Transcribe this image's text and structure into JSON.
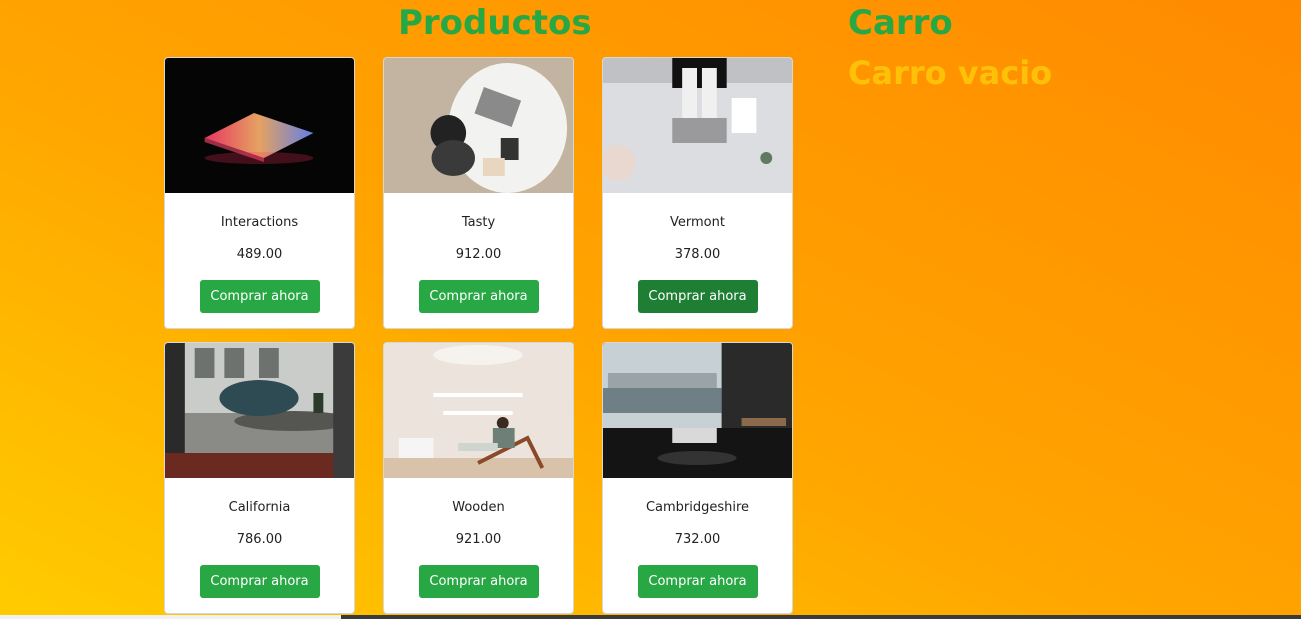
{
  "headings": {
    "products": "Productos",
    "cart": "Carro",
    "cart_empty": "Carro vacio"
  },
  "products": [
    {
      "name": "Interactions",
      "price": "489.00",
      "button": "Comprar ahora",
      "image": "laptop-dark-image"
    },
    {
      "name": "Tasty",
      "price": "912.00",
      "button": "Comprar ahora",
      "image": "desk-overhead-image"
    },
    {
      "name": "Vermont",
      "price": "378.00",
      "button": "Comprar ahora",
      "image": "typing-desk-image"
    },
    {
      "name": "California",
      "price": "786.00",
      "button": "Comprar ahora",
      "image": "living-room-laptop-image"
    },
    {
      "name": "Wooden",
      "price": "921.00",
      "button": "Comprar ahora",
      "image": "lounge-chair-image"
    },
    {
      "name": "Cambridgeshire",
      "price": "732.00",
      "button": "Comprar ahora",
      "image": "city-window-office-image"
    }
  ],
  "colors": {
    "accent_green": "#28a745",
    "empty_text": "#ffc107"
  }
}
